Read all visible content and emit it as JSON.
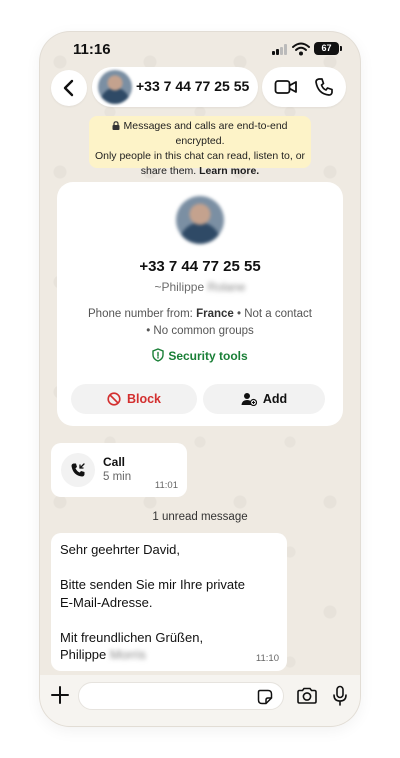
{
  "status": {
    "time": "11:16",
    "battery": "67"
  },
  "header": {
    "contact_number": "+33 7 44 77 25 55"
  },
  "encryption": {
    "line1": "Messages and calls are end-to-end encrypted.",
    "line2": "Only people in this chat can read, listen to, or",
    "line3": "share them.",
    "learn_more": "Learn more."
  },
  "contact_card": {
    "number": "+33 7 44 77 25 55",
    "name_prefix": "~Philippe",
    "name_blurred": "Rolane",
    "info_from_label": "Phone number from:",
    "info_country": "France",
    "info_not_contact": "• Not a contact",
    "info_groups": "• No common groups",
    "security_label": "Security tools",
    "block_label": "Block",
    "add_label": "Add"
  },
  "call_message": {
    "label": "Call",
    "duration": "5 min",
    "time": "11:01"
  },
  "unread_divider": "1 unread message",
  "message": {
    "line1": "Sehr geehrter David,",
    "line2": "Bitte senden Sie mir Ihre private",
    "line3": "E-Mail-Adresse.",
    "line4": "Mit freundlichen Grüßen,",
    "signature_first": "Philippe",
    "signature_blurred": "Morris",
    "time": "11:10"
  },
  "colors": {
    "accent_green": "#1a7f37",
    "block_red": "#d32f2f",
    "notice_bg": "#fdf3c8",
    "chat_bg": "#efeae2"
  }
}
